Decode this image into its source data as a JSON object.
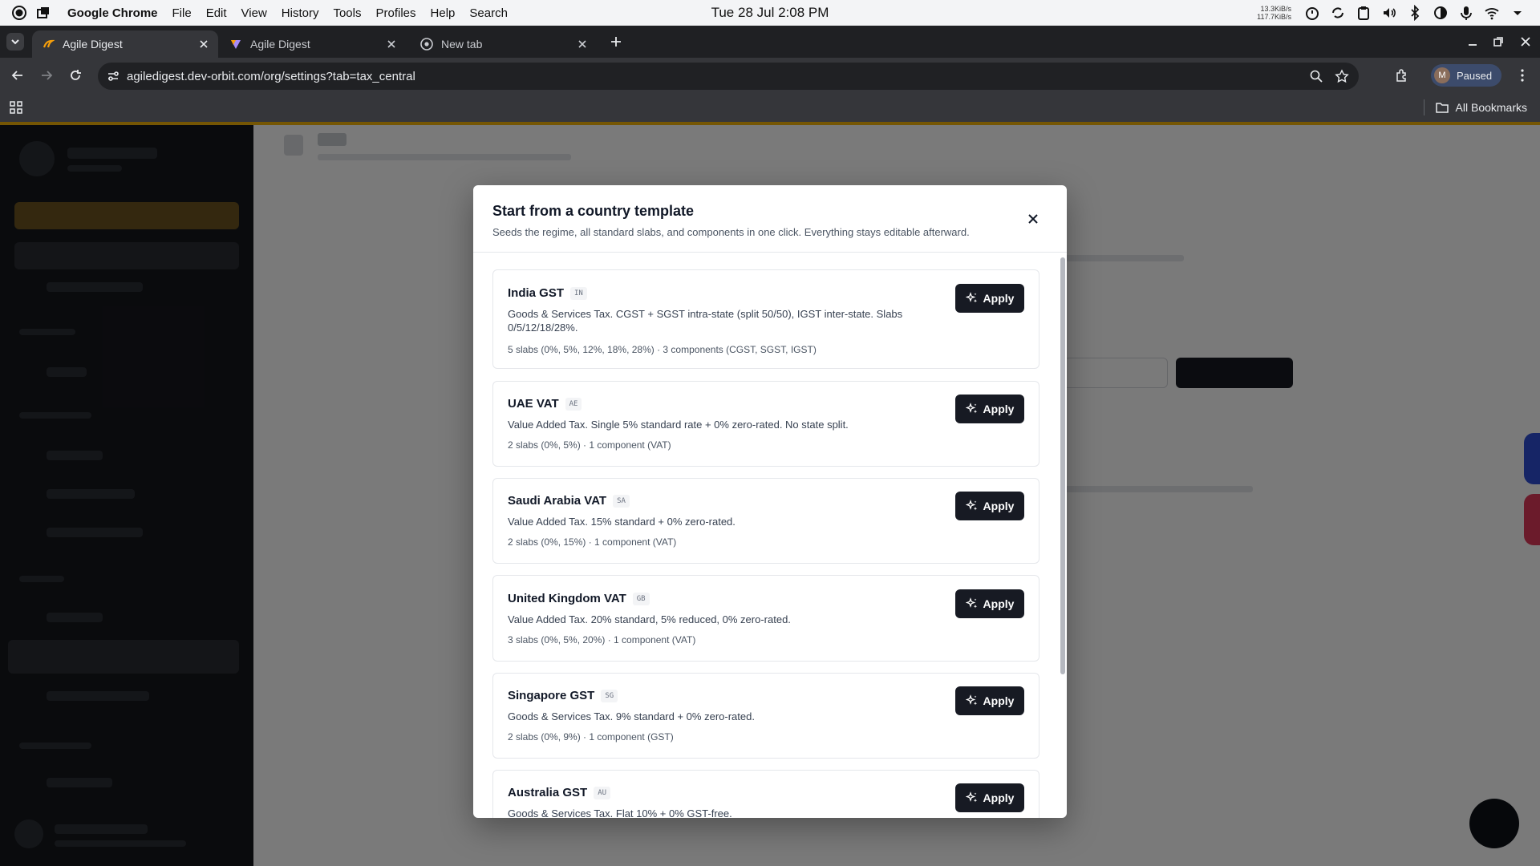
{
  "os": {
    "app_name": "Google Chrome",
    "menus": [
      "File",
      "Edit",
      "View",
      "History",
      "Tools",
      "Profiles",
      "Help",
      "Search"
    ],
    "clock": "Tue 28 Jul  2:08 PM",
    "net_up": "13.3KiB/s",
    "net_down": "117.7KiB/s"
  },
  "browser": {
    "tabs": [
      {
        "title": "Agile Digest",
        "active": true
      },
      {
        "title": "Agile Digest",
        "active": false
      },
      {
        "title": "New tab",
        "active": false
      }
    ],
    "url": "agiledigest.dev-orbit.com/org/settings?tab=tax_central",
    "profile_initial": "M",
    "profile_status": "Paused",
    "bookmarks_label": "All Bookmarks"
  },
  "modal": {
    "title": "Start from a country template",
    "subtitle": "Seeds the regime, all standard slabs, and components in one click. Everything stays editable afterward.",
    "apply_label": "Apply",
    "templates": [
      {
        "name": "India GST",
        "code": "IN",
        "description": "Goods & Services Tax. CGST + SGST intra-state (split 50/50), IGST inter-state. Slabs 0/5/12/18/28%.",
        "meta": "5 slabs (0%, 5%, 12%, 18%, 28%) · 3 components (CGST, SGST, IGST)"
      },
      {
        "name": "UAE VAT",
        "code": "AE",
        "description": "Value Added Tax. Single 5% standard rate + 0% zero-rated. No state split.",
        "meta": "2 slabs (0%, 5%) · 1 component (VAT)"
      },
      {
        "name": "Saudi Arabia VAT",
        "code": "SA",
        "description": "Value Added Tax. 15% standard + 0% zero-rated.",
        "meta": "2 slabs (0%, 15%) · 1 component (VAT)"
      },
      {
        "name": "United Kingdom VAT",
        "code": "GB",
        "description": "Value Added Tax. 20% standard, 5% reduced, 0% zero-rated.",
        "meta": "3 slabs (0%, 5%, 20%) · 1 component (VAT)"
      },
      {
        "name": "Singapore GST",
        "code": "SG",
        "description": "Goods & Services Tax. 9% standard + 0% zero-rated.",
        "meta": "2 slabs (0%, 9%) · 1 component (GST)"
      },
      {
        "name": "Australia GST",
        "code": "AU",
        "description": "Goods & Services Tax. Flat 10% + 0% GST-free.",
        "meta": ""
      }
    ]
  },
  "colors": {
    "accent": "#f5b50a",
    "button_dark": "#171a23",
    "sidebar_bg": "#16181d"
  }
}
